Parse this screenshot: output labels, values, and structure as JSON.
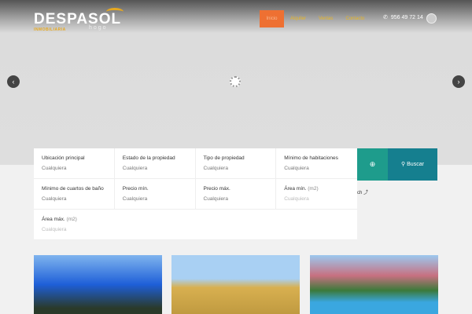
{
  "header": {
    "logo": "DESPASOL",
    "logo_sub": "INMOBILIARIA",
    "logo_tag": "hogo",
    "nav": [
      "Inicio",
      "Alquiler",
      "Ventas",
      "Contacto"
    ],
    "phone": "956 49 72 14"
  },
  "slider": {
    "prev": "‹",
    "next": "›"
  },
  "search": {
    "fields": [
      {
        "label": "Ubicación principal",
        "unit": "",
        "value": "Cualquiera"
      },
      {
        "label": "Estado de la propiedad",
        "unit": "",
        "value": "Cualquiera"
      },
      {
        "label": "Tipo de propiedad",
        "unit": "",
        "value": "Cualquiera"
      },
      {
        "label": "Mínimo de habitaciones",
        "unit": "",
        "value": "Cualquiera"
      },
      {
        "label": "Mínimo de cuartos de baño",
        "unit": "",
        "value": "Cualquiera"
      },
      {
        "label": "Precio mín.",
        "unit": "",
        "value": "Cualquiera"
      },
      {
        "label": "Precio máx.",
        "unit": "",
        "value": "Cualquiera"
      },
      {
        "label": "Área mín.",
        "unit": "(m2)",
        "value": "Cualquiera"
      },
      {
        "label": "Área máx.",
        "unit": "(m2)",
        "value": "Cualquiera"
      }
    ],
    "button": "Buscar",
    "hint": "ch"
  }
}
